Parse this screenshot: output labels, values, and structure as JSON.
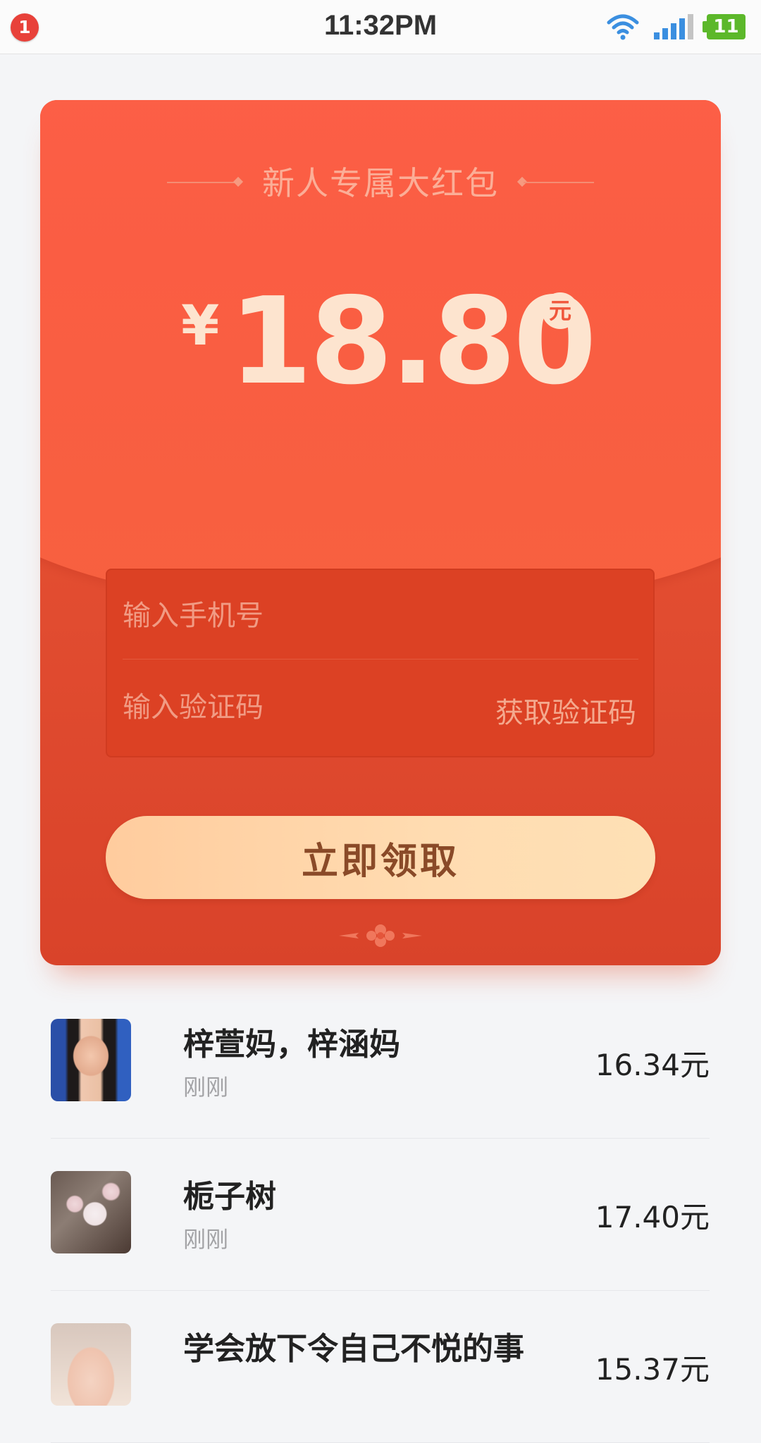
{
  "status_bar": {
    "notification_count": "1",
    "time": "11:32PM",
    "battery": "11",
    "icons": [
      "wifi-icon",
      "signal-icon",
      "battery-icon"
    ]
  },
  "red_packet": {
    "title": "新人专属大红包",
    "currency_symbol": "¥",
    "amount": "18.80",
    "unit": "元",
    "phone_placeholder": "输入手机号",
    "code_placeholder": "输入验证码",
    "get_code_label": "获取验证码",
    "claim_label": "立即领取",
    "colors": {
      "card_red": "#fa5d43",
      "form_red": "#dc4124",
      "button_gold": "#ffd8ad",
      "button_text": "#8a4a28"
    }
  },
  "records": [
    {
      "name": "梓萱妈，梓涵妈",
      "time": "刚刚",
      "amount": "16.34元"
    },
    {
      "name": "栀子树",
      "time": "刚刚",
      "amount": "17.40元"
    },
    {
      "name": "学会放下令自己不悦的事",
      "time": "",
      "amount": "15.37元"
    }
  ]
}
